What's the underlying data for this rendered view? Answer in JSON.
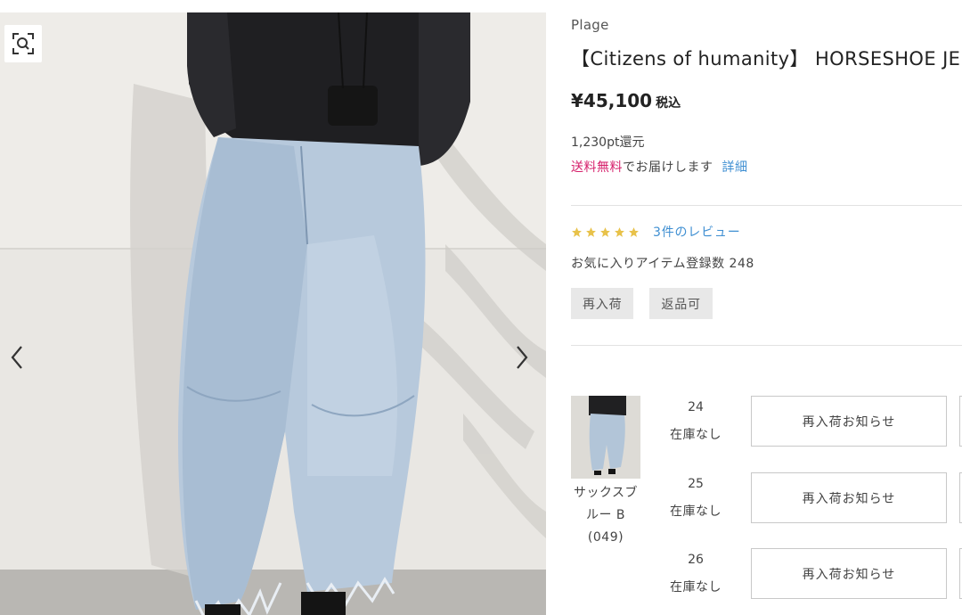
{
  "product": {
    "brand": "Plage",
    "title": "【Citizens of humanity】 HORSESHOE JE",
    "price": "¥45,100",
    "tax_label": "税込",
    "points": "1,230pt還元",
    "shipping_free": "送料無料",
    "shipping_rest": "でお届けします",
    "shipping_detail": "詳細",
    "rating_stars": 5,
    "review_link": "3件のレビュー",
    "favorite_text": "お気に入りアイテム登録数  248",
    "tags": [
      "再入荷",
      "返品可"
    ]
  },
  "gallery": {
    "zoom_icon": "zoom-search-icon",
    "prev_icon": "chevron-left-icon",
    "next_icon": "chevron-right-icon"
  },
  "variant": {
    "name_line1": "サックスブ",
    "name_line2": "ルー B",
    "name_line3": "(049)",
    "sizes": [
      {
        "size": "24",
        "stock": "在庫なし",
        "button": "再入荷お知らせ"
      },
      {
        "size": "25",
        "stock": "在庫なし",
        "button": "再入荷お知らせ"
      },
      {
        "size": "26",
        "stock": "在庫なし",
        "button": "再入荷お知らせ"
      }
    ]
  },
  "colors": {
    "star": "#e8c24a",
    "link": "#3f8fd2",
    "free_shipping": "#d6216c",
    "tag_bg": "#e8e8e8"
  }
}
